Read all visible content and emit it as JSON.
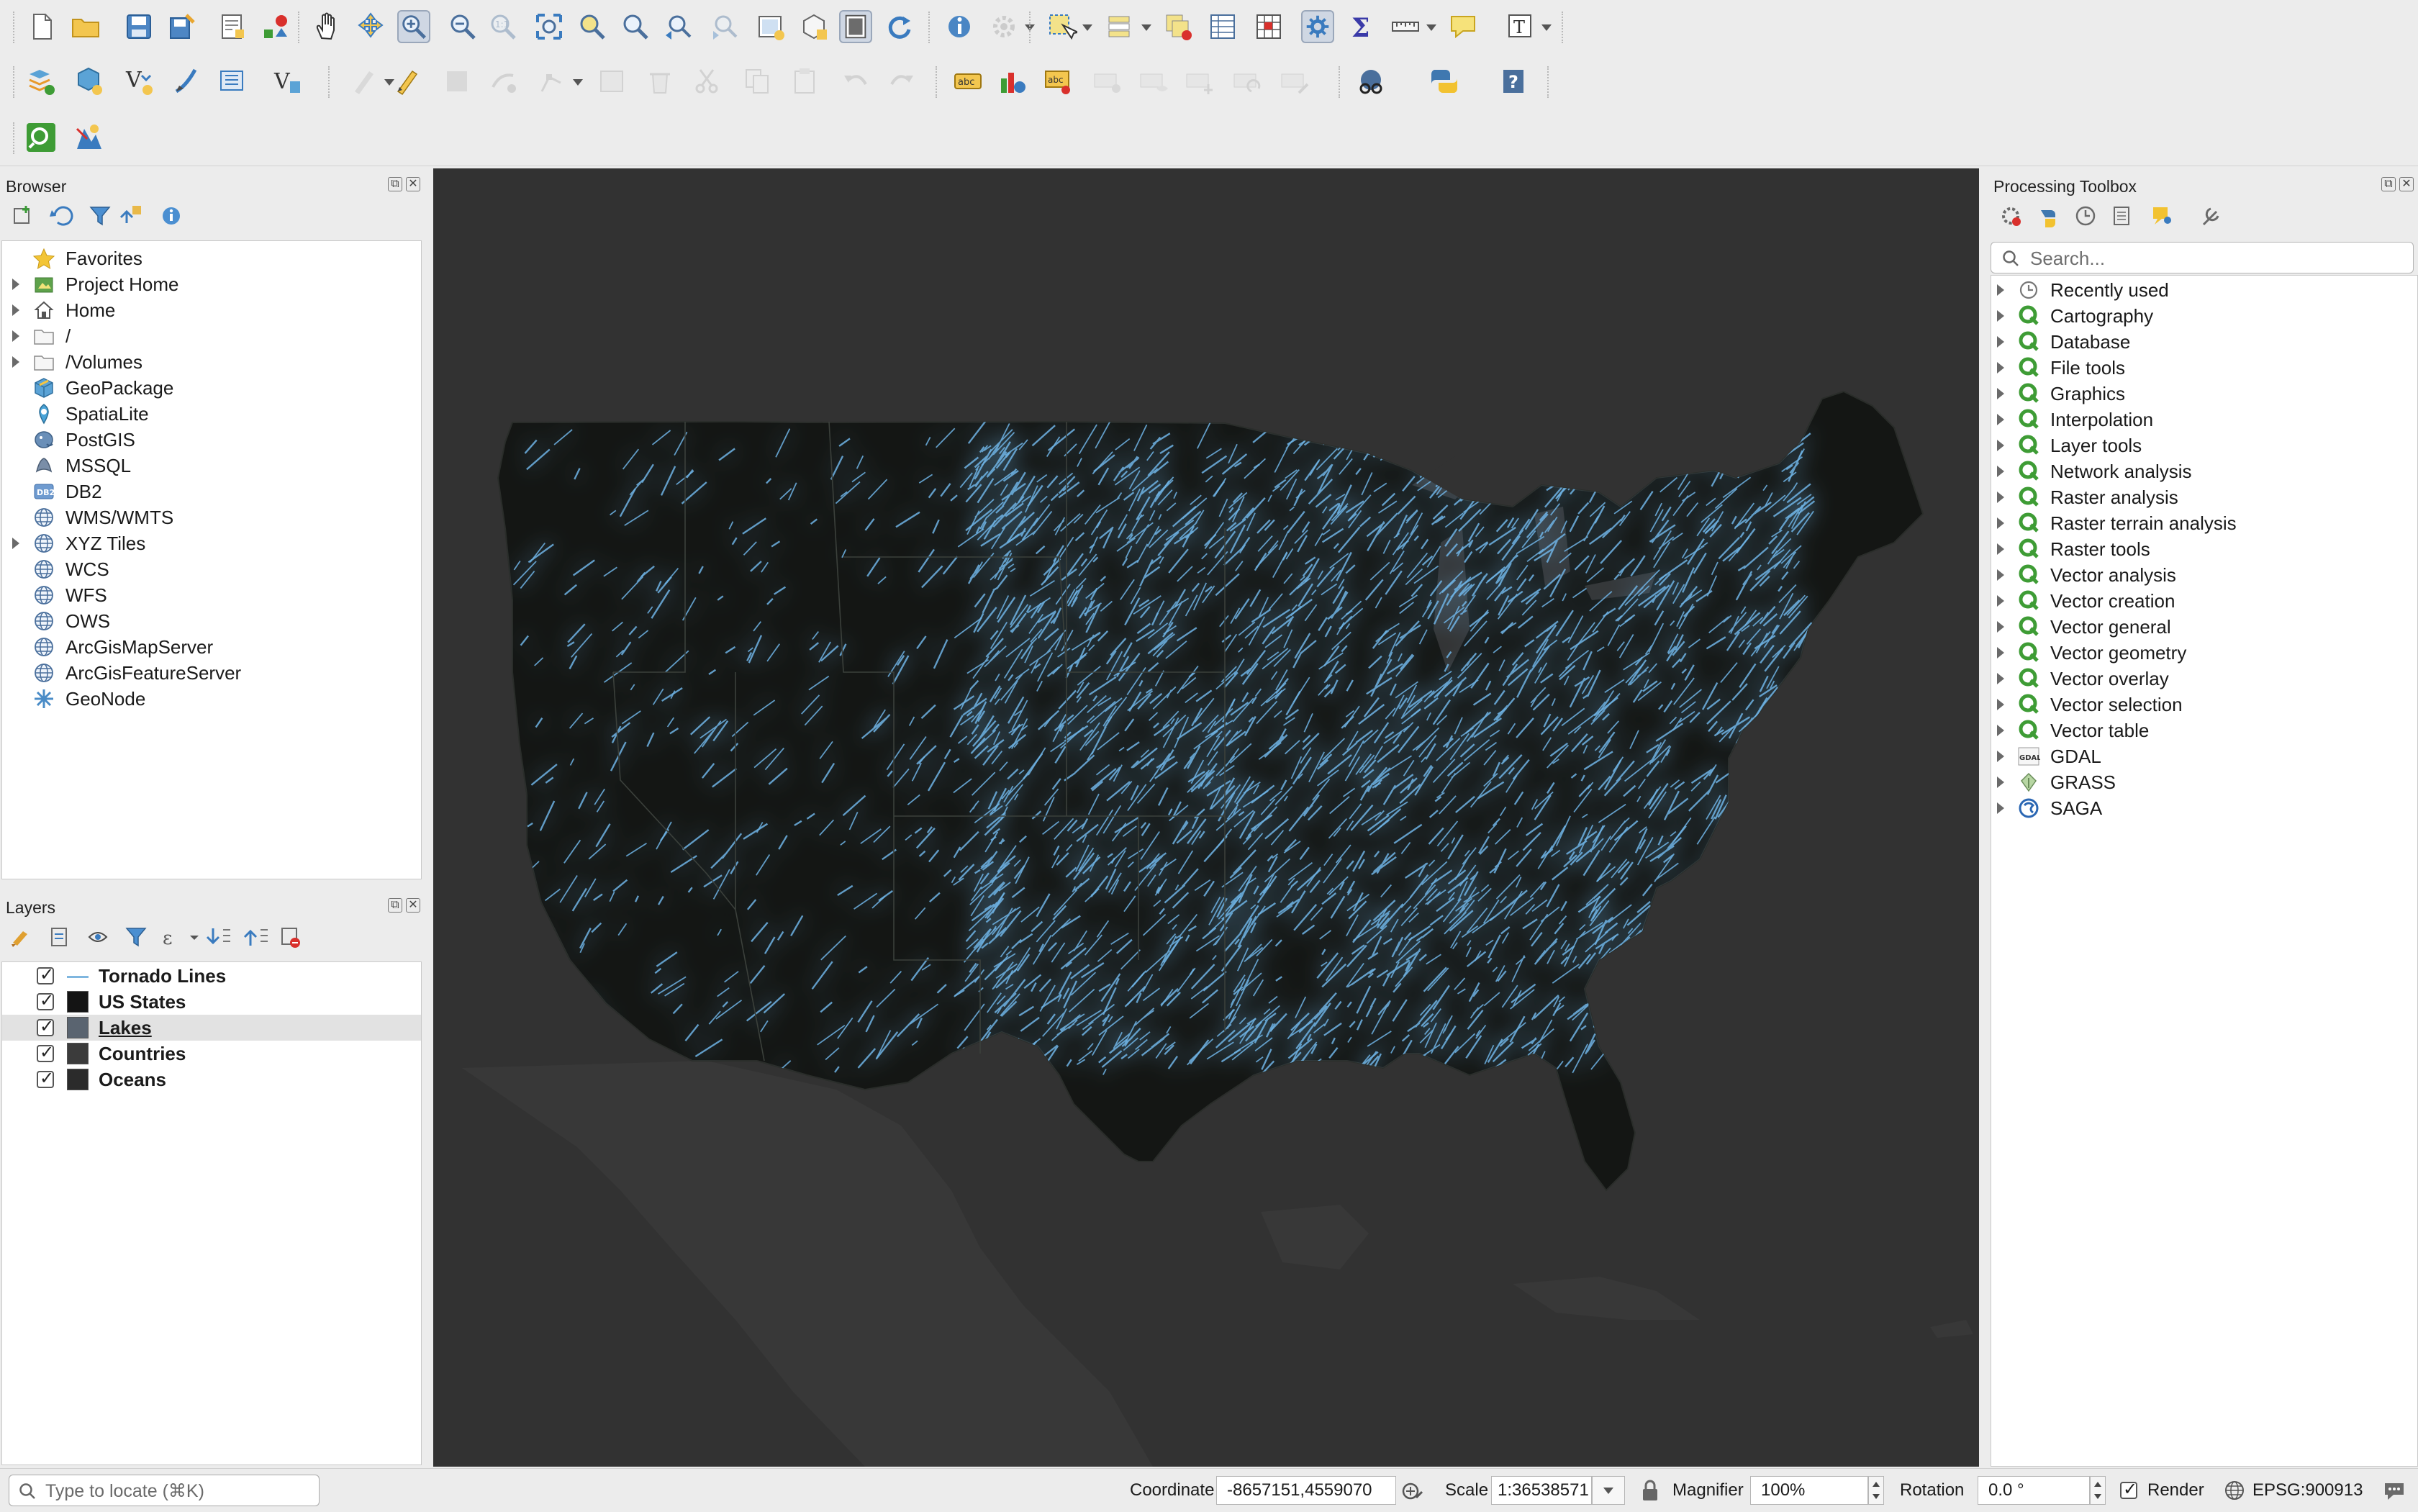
{
  "toolbar": {
    "row1": [
      "new-project-icon",
      "open-project-icon",
      "save-project-icon",
      "save-as-icon",
      "print-layout-icon",
      "style-manager-icon",
      "pan-icon",
      "pan-to-selection-icon",
      "zoom-in-icon",
      "zoom-out-icon",
      "zoom-native-icon",
      "zoom-full-icon",
      "zoom-to-selection-icon",
      "zoom-to-layer-icon",
      "zoom-last-icon",
      "zoom-next-icon",
      "new-map-view-icon",
      "new-3d-map-icon",
      "temporal-controller-icon",
      "refresh-icon",
      "identify-icon",
      "run-action-icon",
      "select-features-icon",
      "select-by-value-icon",
      "deselect-icon",
      "attribute-table-icon",
      "field-calculator-icon",
      "processing-toolbox-icon",
      "statistics-icon",
      "measure-icon",
      "map-tips-icon",
      "text-annotation-icon"
    ],
    "row2": [
      "data-source-manager-icon",
      "new-geopackage-icon",
      "new-shapefile-icon",
      "new-spatialite-icon",
      "new-virtual-layer-icon",
      "new-temporary-layer-icon",
      "current-edits-icon",
      "toggle-editing-icon",
      "save-edits-icon",
      "add-feature-icon",
      "vertex-tool-icon",
      "modify-attributes-icon",
      "delete-selected-icon",
      "cut-features-icon",
      "copy-features-icon",
      "paste-features-icon",
      "undo-icon",
      "redo-icon",
      "label-tool-icon",
      "diagram-tool-icon",
      "layer-labeling-icon",
      "pin-labels-icon",
      "show-hide-labels-icon",
      "move-label-icon",
      "rotate-label-icon",
      "change-label-icon",
      "metasearch-icon",
      "python-console-icon",
      "help-icon"
    ],
    "row3": [
      "locator-icon",
      "georeferencer-icon"
    ]
  },
  "browser": {
    "title": "Browser",
    "items": [
      {
        "label": "Favorites",
        "icon": "star-icon",
        "expandable": false
      },
      {
        "label": "Project Home",
        "icon": "project-home-icon",
        "expandable": true
      },
      {
        "label": "Home",
        "icon": "home-icon",
        "expandable": true
      },
      {
        "label": "/",
        "icon": "folder-icon",
        "expandable": true
      },
      {
        "label": "/Volumes",
        "icon": "folder-icon",
        "expandable": true
      },
      {
        "label": "GeoPackage",
        "icon": "geopackage-icon",
        "expandable": false
      },
      {
        "label": "SpatiaLite",
        "icon": "spatialite-icon",
        "expandable": false
      },
      {
        "label": "PostGIS",
        "icon": "postgis-icon",
        "expandable": false
      },
      {
        "label": "MSSQL",
        "icon": "mssql-icon",
        "expandable": false
      },
      {
        "label": "DB2",
        "icon": "db2-icon",
        "expandable": false
      },
      {
        "label": "WMS/WMTS",
        "icon": "globe-icon",
        "expandable": false
      },
      {
        "label": "XYZ Tiles",
        "icon": "globe-icon",
        "expandable": true
      },
      {
        "label": "WCS",
        "icon": "globe-icon",
        "expandable": false
      },
      {
        "label": "WFS",
        "icon": "globe-icon",
        "expandable": false
      },
      {
        "label": "OWS",
        "icon": "globe-icon",
        "expandable": false
      },
      {
        "label": "ArcGisMapServer",
        "icon": "globe-icon",
        "expandable": false
      },
      {
        "label": "ArcGisFeatureServer",
        "icon": "globe-icon",
        "expandable": false
      },
      {
        "label": "GeoNode",
        "icon": "geonode-icon",
        "expandable": false
      }
    ]
  },
  "layers": {
    "title": "Layers",
    "items": [
      {
        "label": "Tornado Lines",
        "symbol": "line",
        "color": "#7fb6df",
        "checked": true,
        "selected": false
      },
      {
        "label": "US States",
        "symbol": "fill",
        "color": "#141414",
        "checked": true,
        "selected": false
      },
      {
        "label": "Lakes",
        "symbol": "fill",
        "color": "#5a6470",
        "checked": true,
        "selected": true
      },
      {
        "label": "Countries",
        "symbol": "fill",
        "color": "#3b3b3b",
        "checked": true,
        "selected": false
      },
      {
        "label": "Oceans",
        "symbol": "fill",
        "color": "#2b2b2b",
        "checked": true,
        "selected": false
      }
    ]
  },
  "processing": {
    "title": "Processing Toolbox",
    "search_placeholder": "Search...",
    "items": [
      {
        "label": "Recently used",
        "icon": "clock-icon"
      },
      {
        "label": "Cartography",
        "icon": "qgis-icon"
      },
      {
        "label": "Database",
        "icon": "qgis-icon"
      },
      {
        "label": "File tools",
        "icon": "qgis-icon"
      },
      {
        "label": "Graphics",
        "icon": "qgis-icon"
      },
      {
        "label": "Interpolation",
        "icon": "qgis-icon"
      },
      {
        "label": "Layer tools",
        "icon": "qgis-icon"
      },
      {
        "label": "Network analysis",
        "icon": "qgis-icon"
      },
      {
        "label": "Raster analysis",
        "icon": "qgis-icon"
      },
      {
        "label": "Raster terrain analysis",
        "icon": "qgis-icon"
      },
      {
        "label": "Raster tools",
        "icon": "qgis-icon"
      },
      {
        "label": "Vector analysis",
        "icon": "qgis-icon"
      },
      {
        "label": "Vector creation",
        "icon": "qgis-icon"
      },
      {
        "label": "Vector general",
        "icon": "qgis-icon"
      },
      {
        "label": "Vector geometry",
        "icon": "qgis-icon"
      },
      {
        "label": "Vector overlay",
        "icon": "qgis-icon"
      },
      {
        "label": "Vector selection",
        "icon": "qgis-icon"
      },
      {
        "label": "Vector table",
        "icon": "qgis-icon"
      },
      {
        "label": "GDAL",
        "icon": "gdal-icon"
      },
      {
        "label": "GRASS",
        "icon": "grass-icon"
      },
      {
        "label": "SAGA",
        "icon": "saga-icon"
      }
    ]
  },
  "colors": {
    "map_background": "#323232",
    "land": "#141614",
    "tornado_line": "#6fb3e4",
    "qgis_green": "#3e9c35"
  },
  "status": {
    "locate_placeholder": "Type to locate (⌘K)",
    "coordinate_label": "Coordinate",
    "coordinate_value": "-8657151,4559070",
    "scale_label": "Scale",
    "scale_value": "1:36538571",
    "magnifier_label": "Magnifier",
    "magnifier_value": "100%",
    "rotation_label": "Rotation",
    "rotation_value": "0.0 °",
    "render_label": "Render",
    "render_checked": true,
    "crs": "EPSG:900913"
  }
}
